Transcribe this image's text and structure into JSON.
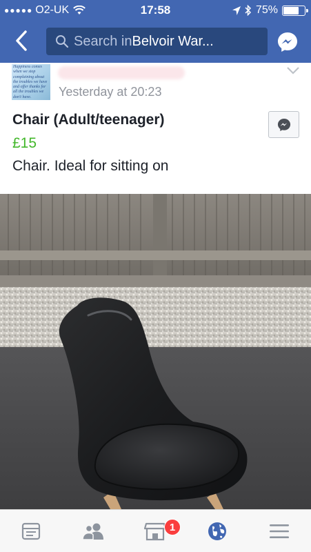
{
  "status_bar": {
    "signal_dots": "●●●●●",
    "carrier": "O2-UK",
    "time": "17:58",
    "battery": "75%",
    "battery_level": 0.75
  },
  "header": {
    "search_prefix": "Search in ",
    "search_group": "Belvoir War...",
    "back_icon": "chevron-left-icon",
    "messenger_icon": "messenger-icon"
  },
  "post": {
    "avatar_text": "Happiness comes when we stop complaining about the troubles we have and offer thanks for all the troubles we don't have.",
    "timestamp": "Yesterday at 20:23",
    "title": "Chair (Adult/teenager)",
    "price": "£15",
    "description": "Chair. Ideal for sitting on"
  },
  "tabbar": {
    "tabs": [
      {
        "icon": "news-feed-icon"
      },
      {
        "icon": "friends-icon"
      },
      {
        "icon": "marketplace-icon",
        "badge": "1"
      },
      {
        "icon": "globe-icon"
      },
      {
        "icon": "menu-icon"
      }
    ]
  },
  "colors": {
    "brand": "#4267b2",
    "price": "#42b72a",
    "badge": "#fa3e3e",
    "active_tab": "#4267b2"
  }
}
